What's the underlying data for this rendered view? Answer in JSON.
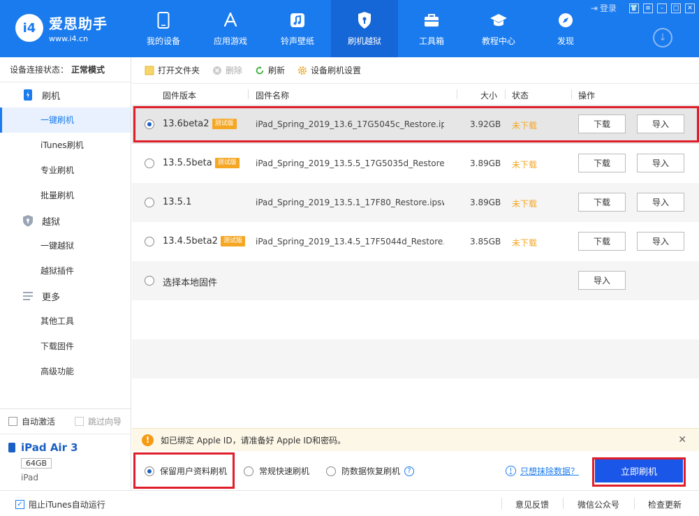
{
  "app": {
    "title": "爱思助手",
    "url": "www.i4.cn",
    "logo_text": "i4"
  },
  "colors": {
    "brand_blue": "#1a7bee",
    "status_orange": "#f5a623",
    "highlight_red": "#e01e2a",
    "primary_button": "#1a56e8"
  },
  "window": {
    "login_label": "登录",
    "buttons": [
      "shirt-icon",
      "menu-icon",
      "minimize-icon",
      "maximize-icon",
      "close-icon"
    ]
  },
  "nav": [
    {
      "label": "我的设备",
      "icon": "phone-icon"
    },
    {
      "label": "应用游戏",
      "icon": "app-store-icon"
    },
    {
      "label": "铃声壁纸",
      "icon": "music-icon"
    },
    {
      "label": "刷机越狱",
      "icon": "shield-icon",
      "active": true
    },
    {
      "label": "工具箱",
      "icon": "toolbox-icon"
    },
    {
      "label": "教程中心",
      "icon": "graduation-cap-icon"
    },
    {
      "label": "发现",
      "icon": "compass-icon"
    }
  ],
  "sidebar": {
    "connection_label": "设备连接状态：",
    "connection_value": "正常模式",
    "groups": [
      {
        "label": "刷机",
        "icon": "phone-flash-icon",
        "items": [
          "一键刷机",
          "iTunes刷机",
          "专业刷机",
          "批量刷机"
        ]
      },
      {
        "label": "越狱",
        "icon": "jailbreak-shield-icon",
        "items": [
          "一键越狱",
          "越狱插件"
        ]
      },
      {
        "label": "更多",
        "icon": "list-icon",
        "items": [
          "其他工具",
          "下载固件",
          "高级功能"
        ]
      }
    ],
    "active_item": "一键刷机",
    "auto_activate": "自动激活",
    "skip_guide": "跳过向导",
    "device": {
      "name": "iPad Air 3",
      "capacity": "64GB",
      "type": "iPad"
    }
  },
  "toolbar": {
    "open_folder": "打开文件夹",
    "delete": "删除",
    "refresh": "刷新",
    "settings": "设备刷机设置"
  },
  "table": {
    "headers": {
      "version": "固件版本",
      "name": "固件名称",
      "size": "大小",
      "status": "状态",
      "action": "操作"
    },
    "rows": [
      {
        "version": "13.6beta2",
        "beta": "测试版",
        "name": "iPad_Spring_2019_13.6_17G5045c_Restore.ip...",
        "size": "3.92GB",
        "status": "未下载",
        "selected": true
      },
      {
        "version": "13.5.5beta",
        "beta": "测试版",
        "name": "iPad_Spring_2019_13.5.5_17G5035d_Restore....",
        "size": "3.89GB",
        "status": "未下载"
      },
      {
        "version": "13.5.1",
        "beta": "",
        "name": "iPad_Spring_2019_13.5.1_17F80_Restore.ipsw",
        "size": "3.89GB",
        "status": "未下载",
        "info": true
      },
      {
        "version": "13.4.5beta2",
        "beta": "测试版",
        "name": "iPad_Spring_2019_13.4.5_17F5044d_Restore.i...",
        "size": "3.85GB",
        "status": "未下载"
      }
    ],
    "local_firmware": "选择本地固件",
    "download_label": "下载",
    "import_label": "导入"
  },
  "notice": {
    "text": "如已绑定 Apple ID，请准备好 Apple ID和密码。"
  },
  "flash_options": {
    "keep_data": "保留用户资料刷机",
    "quick": "常规快速刷机",
    "anti_recovery": "防数据恢复刷机",
    "erase_link": "只想抹除数据？",
    "flash_now": "立即刷机"
  },
  "statusbar": {
    "block_itunes": "阻止iTunes自动运行",
    "feedback": "意见反馈",
    "wechat": "微信公众号",
    "update": "检查更新"
  }
}
